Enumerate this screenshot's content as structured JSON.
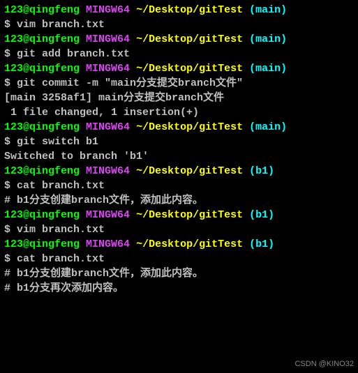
{
  "prompt": {
    "user": "123@qingfeng",
    "env": "MINGW64",
    "path": "~/Desktop/gitTest",
    "branch_main": "(main)",
    "branch_b1": "(b1)",
    "sep": " ",
    "dollar": "$ "
  },
  "blocks": [
    {
      "branch": "main",
      "cmd": "vim branch.txt",
      "out": []
    },
    {
      "branch": "main",
      "cmd": "git add branch.txt",
      "out": []
    },
    {
      "branch": "main",
      "cmd": "git commit -m \"main分支提交branch文件\"",
      "out": [
        "[main 3258af1] main分支提交branch文件",
        " 1 file changed, 1 insertion(+)"
      ]
    },
    {
      "branch": "main",
      "cmd": "git switch b1",
      "out": [
        "Switched to branch 'b1'"
      ]
    },
    {
      "branch": "b1",
      "cmd": "cat branch.txt",
      "out": [
        "# b1分支创建branch文件，添加此内容。"
      ]
    },
    {
      "branch": "b1",
      "cmd": "vim branch.txt",
      "out": []
    },
    {
      "branch": "b1",
      "cmd": "cat branch.txt",
      "out": [
        "# b1分支创建branch文件，添加此内容。",
        "# b1分支再次添加内容。"
      ]
    }
  ],
  "watermark": "CSDN @KINO32"
}
